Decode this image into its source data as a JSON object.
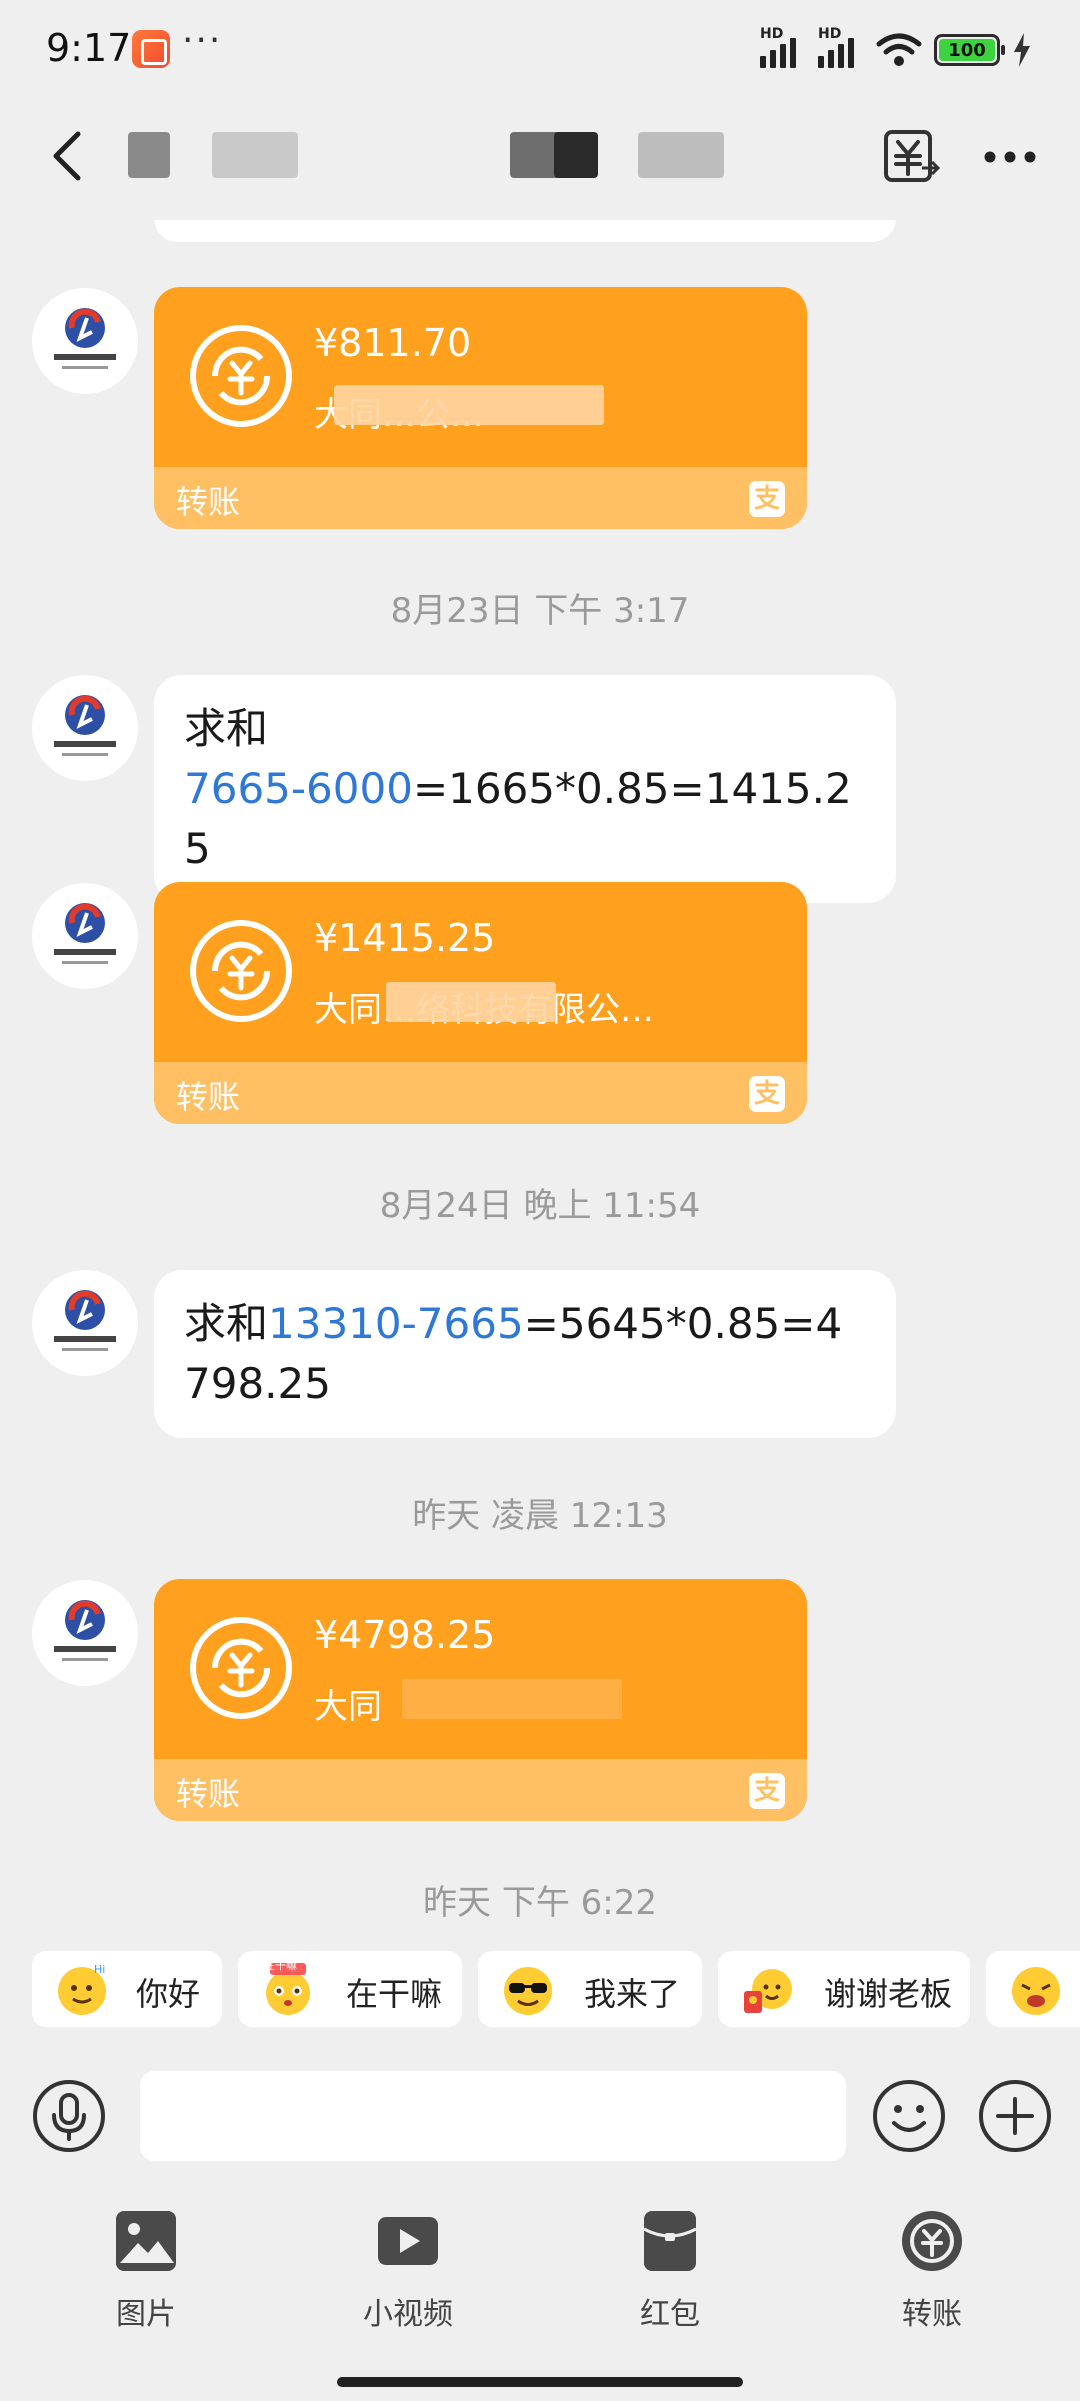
{
  "status_bar": {
    "time": "9:17",
    "dots": "···",
    "network_label": "HD",
    "battery": "100"
  },
  "nav": {
    "back_icon": "chevron-left-icon",
    "title": "",
    "transfer_record_icon": "yuan-transfer-icon",
    "more_icon": "more-dots-icon"
  },
  "messages": [
    {
      "type": "transfer",
      "amount": "¥811.70",
      "payee": "大同…公…",
      "label": "转账"
    },
    {
      "type": "timestamp",
      "text": "8月23日 下午 3:17"
    },
    {
      "type": "text",
      "parts": [
        "求和",
        "7665-6000",
        "=1665*0.85=1415.25"
      ]
    },
    {
      "type": "transfer",
      "amount": "¥1415.25",
      "payee": "大同…络科技有限公…",
      "label": "转账"
    },
    {
      "type": "timestamp",
      "text": "8月24日 晚上 11:54"
    },
    {
      "type": "text",
      "parts": [
        "求和",
        "13310-7665",
        "=5645*0.85=4798.25"
      ]
    },
    {
      "type": "timestamp",
      "text": "昨天 凌晨 12:13"
    },
    {
      "type": "transfer",
      "amount": "¥4798.25",
      "payee": "大同",
      "label": "转账"
    },
    {
      "type": "timestamp",
      "text": "昨天 下午 6:22"
    }
  ],
  "quick_replies": [
    "你好",
    "在干嘛",
    "我来了",
    "谢谢老板"
  ],
  "quick_reply_badge": "在干嘛",
  "input": {
    "placeholder": ""
  },
  "tools": [
    {
      "label": "图片",
      "icon": "image-icon"
    },
    {
      "label": "小视频",
      "icon": "video-icon"
    },
    {
      "label": "红包",
      "icon": "red-packet-icon"
    },
    {
      "label": "转账",
      "icon": "transfer-icon"
    }
  ],
  "colors": {
    "background": "#efefef",
    "transfer_card": "#ffa01e",
    "transfer_footer": "#ffbf63",
    "link": "#2f78d6",
    "battery": "#3dd23f"
  }
}
